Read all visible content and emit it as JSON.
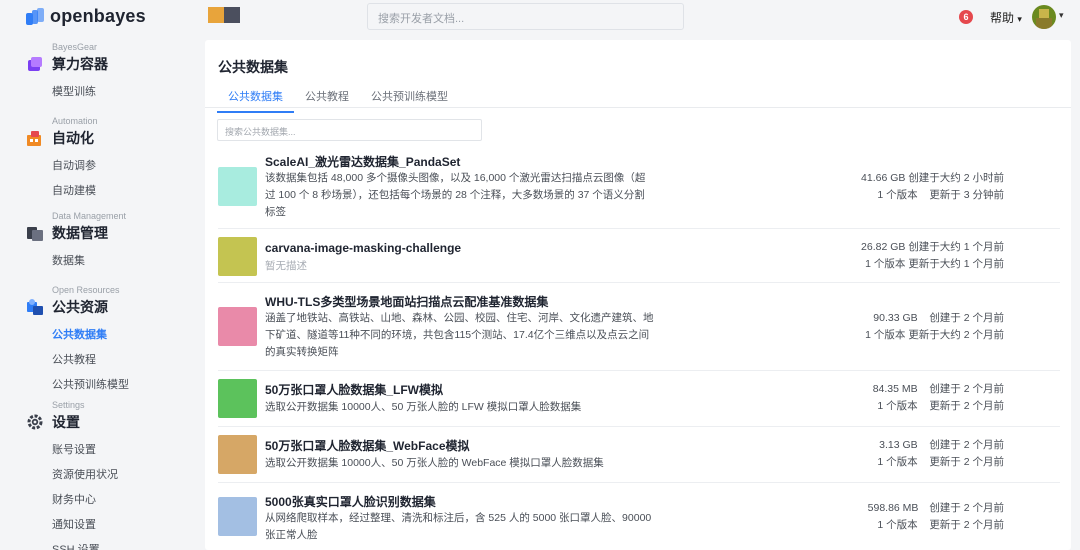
{
  "brand": {
    "name": "openbayes",
    "colors": {
      "accent": "#2f7df6",
      "badge": "#e5484d"
    }
  },
  "header": {
    "swatch_colors": [
      "#e8a43b",
      "#4b4f5e"
    ],
    "search_placeholder": "搜索开发者文档...",
    "notification_count": "6",
    "help_label": "帮助",
    "help_caret": "▾",
    "avatar_caret": "▾"
  },
  "sidebar": {
    "sections": [
      {
        "eyebrow": "BayesGear",
        "title": "算力容器",
        "icon": "cube-icon",
        "items": [
          "模型训练"
        ]
      },
      {
        "eyebrow": "Automation",
        "title": "自动化",
        "icon": "automation-icon",
        "items": [
          "自动调参",
          "自动建模"
        ]
      },
      {
        "eyebrow": "Data Management",
        "title": "数据管理",
        "icon": "data-management-icon",
        "items": [
          "数据集"
        ]
      },
      {
        "eyebrow": "Open Resources",
        "title": "公共资源",
        "icon": "public-resources-icon",
        "items": [
          "公共数据集",
          "公共教程",
          "公共预训练模型"
        ],
        "active_index": 0
      },
      {
        "eyebrow": "Settings",
        "title": "设置",
        "icon": "gear-icon",
        "items": [
          "账号设置",
          "资源使用状况",
          "财务中心",
          "通知设置",
          "SSH 设置"
        ]
      }
    ]
  },
  "main": {
    "title": "公共数据集",
    "tabs": [
      {
        "label": "公共数据集",
        "active": true
      },
      {
        "label": "公共教程",
        "active": false
      },
      {
        "label": "公共预训练模型",
        "active": false
      }
    ],
    "search_placeholder": "搜索公共数据集...",
    "datasets": [
      {
        "title": "ScaleAI_激光雷达数据集_PandaSet",
        "description": "该数据集包括 48,000 多个摄像头图像，以及 16,000 个激光雷达扫描点云图像（超过 100 个 8 秒场景），还包括每个场景的 28 个注释，大多数场景的 37 个语义分割标签",
        "size": "41.66 GB",
        "created": "创建于大约 2 小时前",
        "versions": "1 个版本",
        "updated": "更新于 3 分钟前",
        "thumb_color": "#a8ecdf"
      },
      {
        "title": "carvana-image-masking-challenge",
        "description": "暂无描述",
        "muted": true,
        "size": "26.82 GB",
        "created": "创建于大约 1 个月前",
        "versions": "1 个版本",
        "updated": "更新于大约 1 个月前",
        "thumb_color": "#c4c451"
      },
      {
        "title": "WHU-TLS多类型场景地面站扫描点云配准基准数据集",
        "description": "涵盖了地铁站、高铁站、山地、森林、公园、校园、住宅、河岸、文化遗产建筑、地下矿道、隧道等11种不同的环境，共包含115个测站、17.4亿个三维点以及点云之间的真实转换矩阵",
        "size": "90.33 GB",
        "created": "创建于 2 个月前",
        "versions": "1 个版本",
        "updated": "更新于大约 2 个月前",
        "thumb_color": "#e98aa9"
      },
      {
        "title": "50万张口罩人脸数据集_LFW模拟",
        "description": "选取公开数据集 10000人、50 万张人脸的 LFW 模拟口罩人脸数据集",
        "size": "84.35 MB",
        "created": "创建于 2 个月前",
        "versions": "1 个版本",
        "updated": "更新于 2 个月前",
        "thumb_color": "#5cc25c"
      },
      {
        "title": "50万张口罩人脸数据集_WebFace模拟",
        "description": "选取公开数据集 10000人、50 万张人脸的 WebFace 模拟口罩人脸数据集",
        "size": "3.13 GB",
        "created": "创建于 2 个月前",
        "versions": "1 个版本",
        "updated": "更新于 2 个月前",
        "thumb_color": "#d6a766"
      },
      {
        "title": "5000张真实口罩人脸识别数据集",
        "description": "从网络爬取样本，经过整理、清洗和标注后，含 525 人的 5000 张口罩人脸、90000 张正常人脸",
        "size": "598.86 MB",
        "created": "创建于 2 个月前",
        "versions": "1 个版本",
        "updated": "更新于 2 个月前",
        "thumb_color": "#a3bfe3"
      }
    ]
  }
}
